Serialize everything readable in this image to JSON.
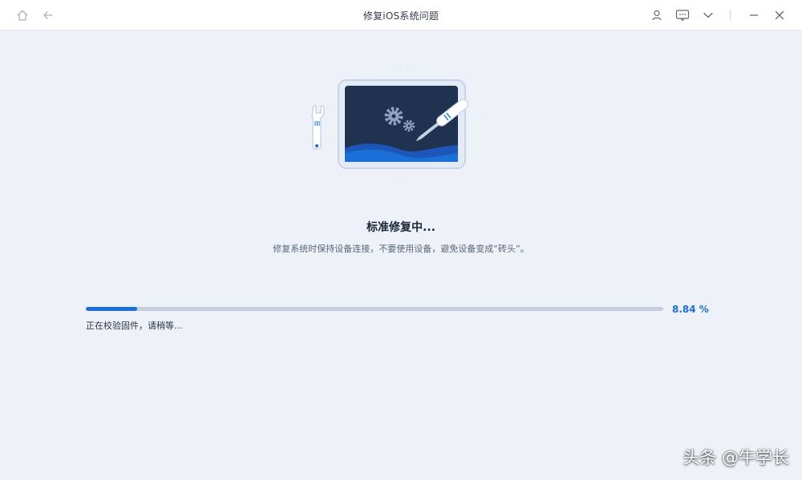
{
  "window": {
    "title": "修复iOS系统问题"
  },
  "titlebar": {
    "left_icons": [
      "home-icon",
      "back-arrow-icon"
    ],
    "right_icons": [
      "user-icon",
      "feedback-icon",
      "chevron-down-icon",
      "minimize-icon",
      "close-icon"
    ]
  },
  "main": {
    "heading": "标准修复中...",
    "subtext": "修复系统时保持设备连接，不要使用设备，避免设备变成“砖头”。"
  },
  "progress": {
    "fraction": 0.0884,
    "value_text": "8.84 %",
    "status": "正在校验固件，请稍等..."
  },
  "watermark": "头条 @牛学长",
  "colors": {
    "accent": "#1a6fd8",
    "background": "#eef2f8",
    "track": "#c5cedd",
    "screen": "#1f3350"
  }
}
